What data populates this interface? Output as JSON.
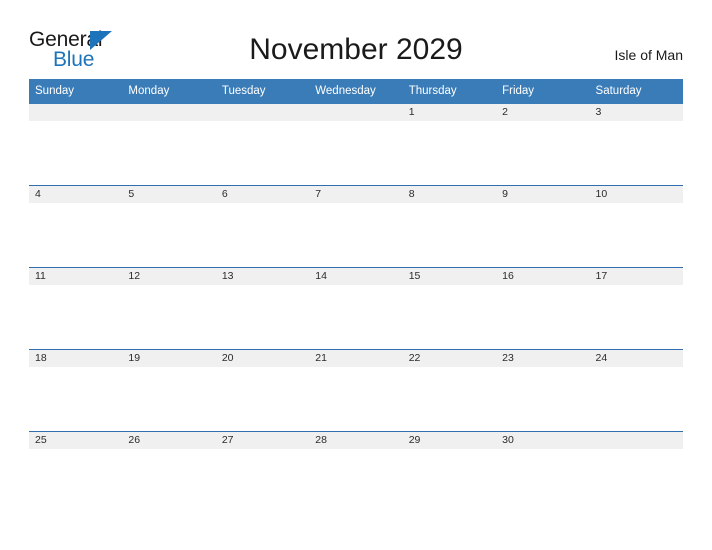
{
  "brand": {
    "name_part1": "General",
    "name_part2": "Blue",
    "logo_icon": "blue-triangle-logo"
  },
  "header": {
    "title": "November 2029",
    "location": "Isle of Man"
  },
  "calendar": {
    "month": "November",
    "year": "2029",
    "weekday_headers": [
      "Sunday",
      "Monday",
      "Tuesday",
      "Wednesday",
      "Thursday",
      "Friday",
      "Saturday"
    ],
    "weeks": [
      [
        "",
        "",
        "",
        "",
        "1",
        "2",
        "3"
      ],
      [
        "4",
        "5",
        "6",
        "7",
        "8",
        "9",
        "10"
      ],
      [
        "11",
        "12",
        "13",
        "14",
        "15",
        "16",
        "17"
      ],
      [
        "18",
        "19",
        "20",
        "21",
        "22",
        "23",
        "24"
      ],
      [
        "25",
        "26",
        "27",
        "28",
        "29",
        "30",
        ""
      ]
    ]
  },
  "colors": {
    "header_blue": "#3A7CB8",
    "row_divider_blue": "#2F6FAE",
    "day_band_gray": "#F0F0F0",
    "logo_blue": "#1D74BB",
    "text_dark": "#1A1A1A",
    "page_background": "#FFFFFF"
  }
}
